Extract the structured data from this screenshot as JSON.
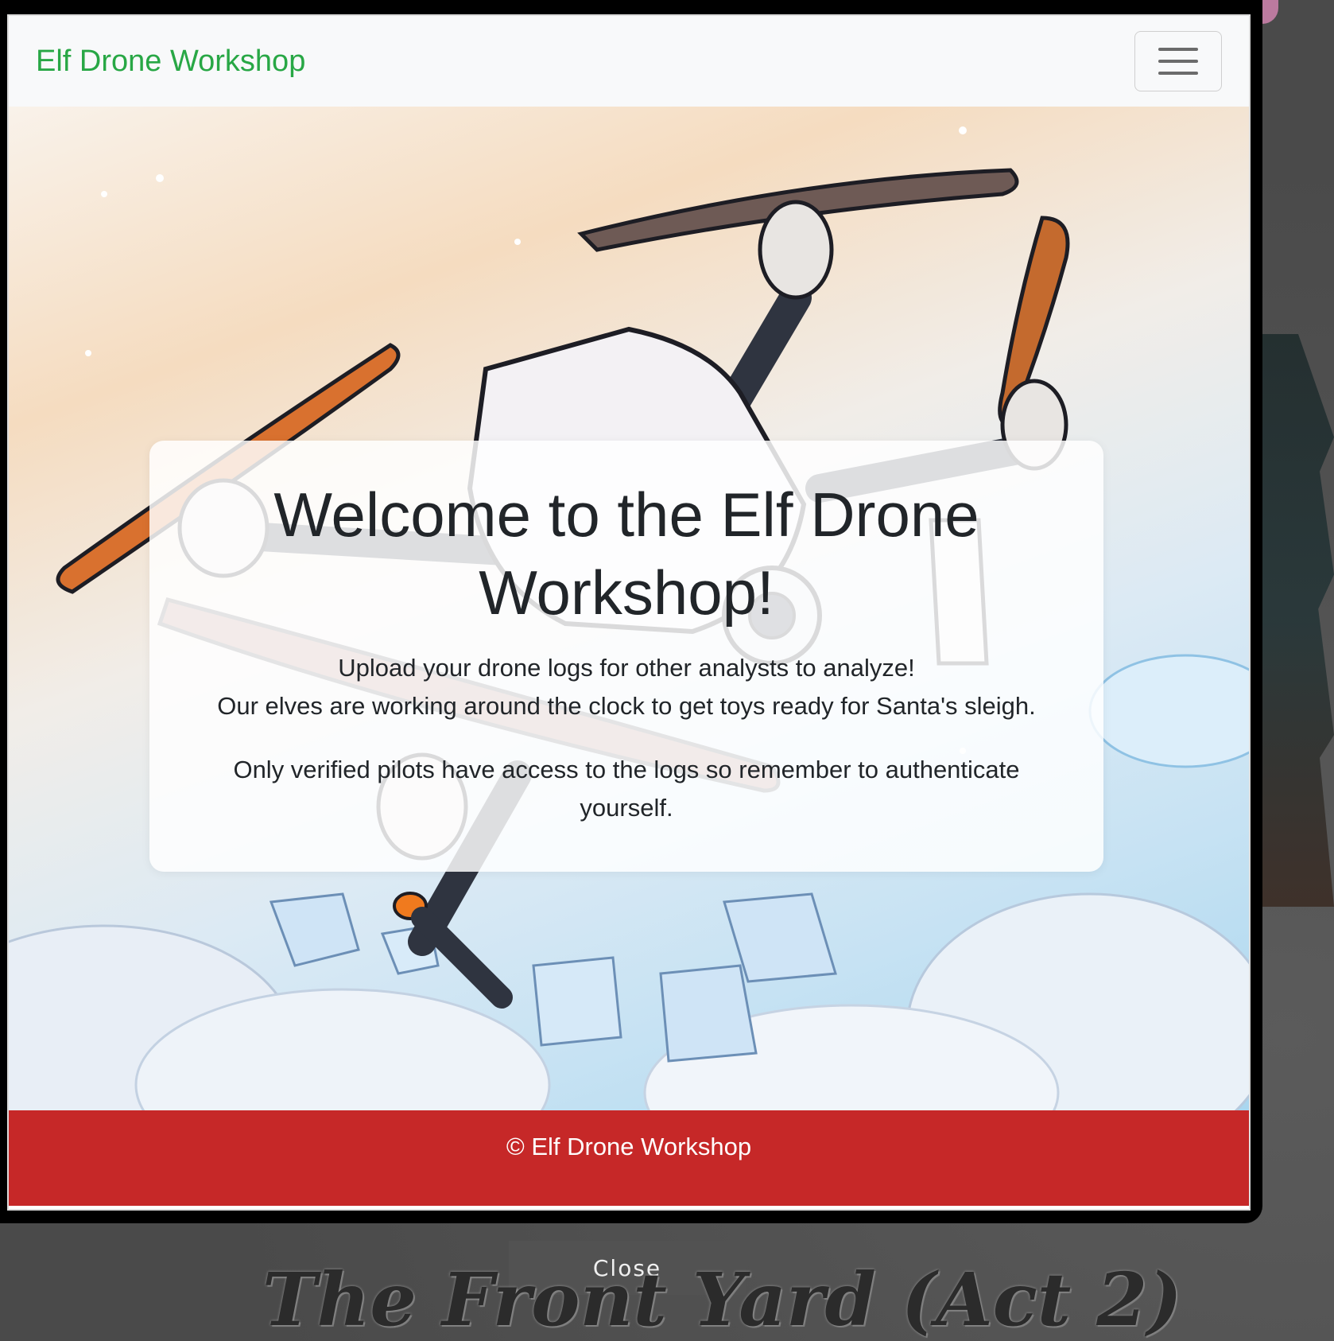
{
  "navbar": {
    "brand": "Elf Drone Workshop",
    "toggler_icon": "hamburger-menu-icon"
  },
  "welcome": {
    "title": "Welcome to the Elf Drone Workshop!",
    "line1": "Upload your drone logs for other analysts to analyze!",
    "line2": "Our elves are working around the clock to get toys ready for Santa's sleigh.",
    "line3": "Only verified pilots have access to the logs so remember to authenticate yourself."
  },
  "footer": {
    "text": "© Elf Drone Workshop"
  },
  "overlay": {
    "close_label": "Close",
    "scene_title": "The Front Yard (Act 2)"
  },
  "colors": {
    "brand_green": "#28a745",
    "footer_red": "#c62828",
    "navbar_bg": "#f8f9fa"
  }
}
